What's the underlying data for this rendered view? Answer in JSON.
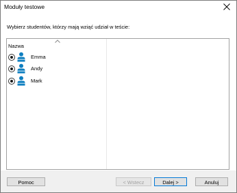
{
  "window": {
    "title": "Moduły testowe",
    "close_glyph": "close-icon"
  },
  "instruction": "Wybierz studentów, którzy mają wziąć udział w teście:",
  "list": {
    "column_header": "Nazwa",
    "sort_indicator": "chevron-up-icon",
    "items": [
      {
        "label": "Emma",
        "selected": true,
        "icon": "user-icon"
      },
      {
        "label": "Andy",
        "selected": true,
        "icon": "user-icon"
      },
      {
        "label": "Mark",
        "selected": true,
        "icon": "user-icon"
      }
    ]
  },
  "buttons": {
    "help": "Pomoc",
    "back": "< Wstecz",
    "next": "Dalej >",
    "cancel": "Anuluj"
  },
  "colors": {
    "user_icon": "#0f7fc0",
    "default_button_border": "#0078d7"
  }
}
